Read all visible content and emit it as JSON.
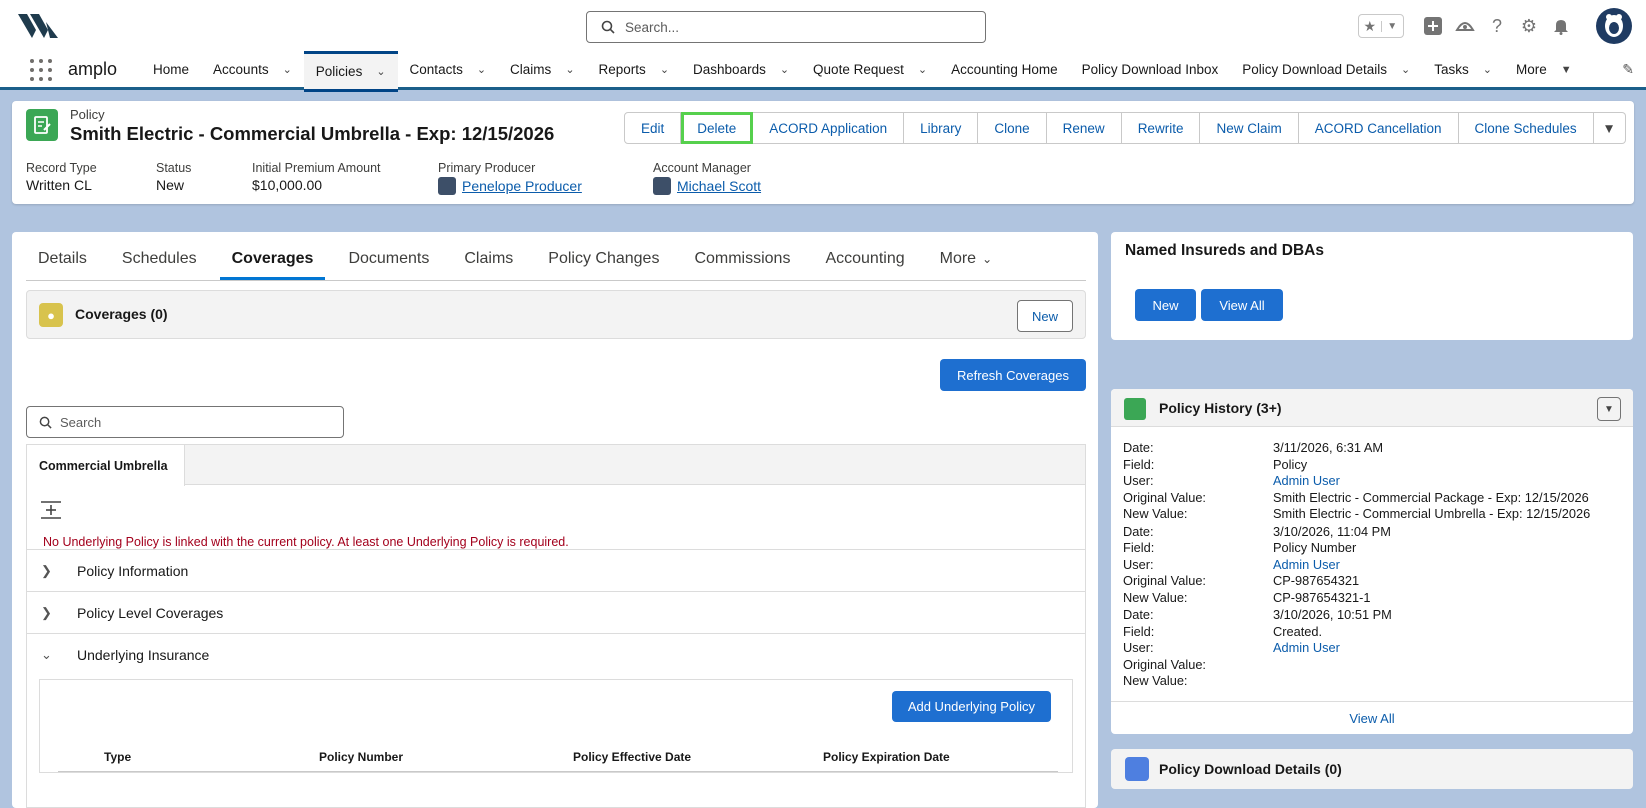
{
  "header": {
    "search_placeholder": "Search...",
    "app_name": "amplo"
  },
  "nav": {
    "items": [
      {
        "label": "Home",
        "dropdown": false
      },
      {
        "label": "Accounts",
        "dropdown": true
      },
      {
        "label": "Policies",
        "dropdown": true,
        "active": true
      },
      {
        "label": "Contacts",
        "dropdown": true
      },
      {
        "label": "Claims",
        "dropdown": true
      },
      {
        "label": "Reports",
        "dropdown": true
      },
      {
        "label": "Dashboards",
        "dropdown": true
      },
      {
        "label": "Quote Request",
        "dropdown": true
      },
      {
        "label": "Accounting Home",
        "dropdown": false
      },
      {
        "label": "Policy Download Inbox",
        "dropdown": false
      },
      {
        "label": "Policy Download Details",
        "dropdown": true
      },
      {
        "label": "Tasks",
        "dropdown": true
      },
      {
        "label": "More",
        "dropdown": true
      }
    ]
  },
  "record": {
    "object_label": "Policy",
    "title": "Smith Electric - Commercial Umbrella - Exp: 12/15/2026",
    "actions": [
      "Edit",
      "Delete",
      "ACORD Application",
      "Library",
      "Clone",
      "Renew",
      "Rewrite",
      "New Claim",
      "ACORD Cancellation",
      "Clone Schedules"
    ],
    "fields": {
      "record_type_label": "Record Type",
      "record_type_value": "Written CL",
      "status_label": "Status",
      "status_value": "New",
      "premium_label": "Initial Premium Amount",
      "premium_value": "$10,000.00",
      "producer_label": "Primary Producer",
      "producer_value": "Penelope Producer",
      "manager_label": "Account Manager",
      "manager_value": "Michael Scott"
    }
  },
  "tabs": [
    "Details",
    "Schedules",
    "Coverages",
    "Documents",
    "Claims",
    "Policy Changes",
    "Commissions",
    "Accounting",
    "More"
  ],
  "coverages": {
    "title": "Coverages (0)",
    "new_label": "New",
    "refresh_label": "Refresh Coverages",
    "search_placeholder": "Search",
    "subtab": "Commercial Umbrella",
    "error": "No Underlying Policy is linked with the current policy. At least one Underlying Policy is required.",
    "sections": [
      "Policy Information",
      "Policy Level Coverages",
      "Underlying Insurance"
    ],
    "add_underlying_label": "Add Underlying Policy",
    "columns": [
      "Type",
      "Policy Number",
      "Policy Effective Date",
      "Policy Expiration Date"
    ]
  },
  "named_insureds": {
    "title": "Named Insureds and DBAs",
    "new_label": "New",
    "view_all_label": "View All"
  },
  "history": {
    "title": "Policy History (3+)",
    "labels": {
      "date": "Date:",
      "field": "Field:",
      "user": "User:",
      "original": "Original Value:",
      "new": "New Value:"
    },
    "entries": [
      {
        "date": "3/11/2026, 6:31 AM",
        "field": "Policy",
        "user": "Admin User",
        "original": "Smith Electric - Commercial Package - Exp: 12/15/2026",
        "new": "Smith Electric - Commercial Umbrella - Exp: 12/15/2026"
      },
      {
        "date": "3/10/2026, 11:04 PM",
        "field": "Policy Number",
        "user": "Admin User",
        "original": "CP-987654321",
        "new": "CP-987654321-1"
      },
      {
        "date": "3/10/2026, 10:51 PM",
        "field": "Created.",
        "user": "Admin User",
        "original": "",
        "new": ""
      }
    ],
    "view_all_label": "View All"
  },
  "policy_download": {
    "title": "Policy Download Details (0)"
  },
  "colors": {
    "brand_blue": "#1e6fd0",
    "link": "#0b5cab",
    "policy_green": "#3ba755",
    "highlight": "#56d04d",
    "error": "#a3001c"
  }
}
